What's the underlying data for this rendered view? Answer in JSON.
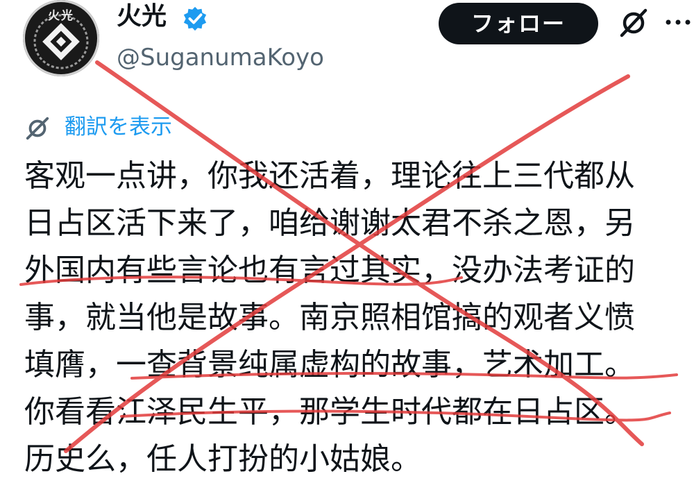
{
  "author": {
    "avatar_text": "火光",
    "display_name": "火光",
    "handle": "@SuganumaKoyo",
    "verified": true
  },
  "actions": {
    "follow_label": "フォロー",
    "grok_icon": "grok-icon",
    "more_icon": "more-icon"
  },
  "translate": {
    "label": "翻訳を表示"
  },
  "post": {
    "lines": [
      "客观一点讲，你我还活着，理论往上三代都从",
      "日占区活下来了，咱给谢谢太君不杀之恩，另",
      "外国内有些言论也有言过其实，没办法考证的",
      "事，就当他是故事。南京照相馆搞的观者义愤",
      "填膺，一查背景纯属虚构的故事，艺术加工。",
      "你看看江泽民生平，那学生时代都在日占区。",
      "历史么，任人打扮的小姑娘。"
    ]
  },
  "colors": {
    "accent_blue": "#1d9bf0",
    "follow_bg": "#0f1419",
    "handle_gray": "#536471",
    "annotation_red": "#e23b3b"
  }
}
